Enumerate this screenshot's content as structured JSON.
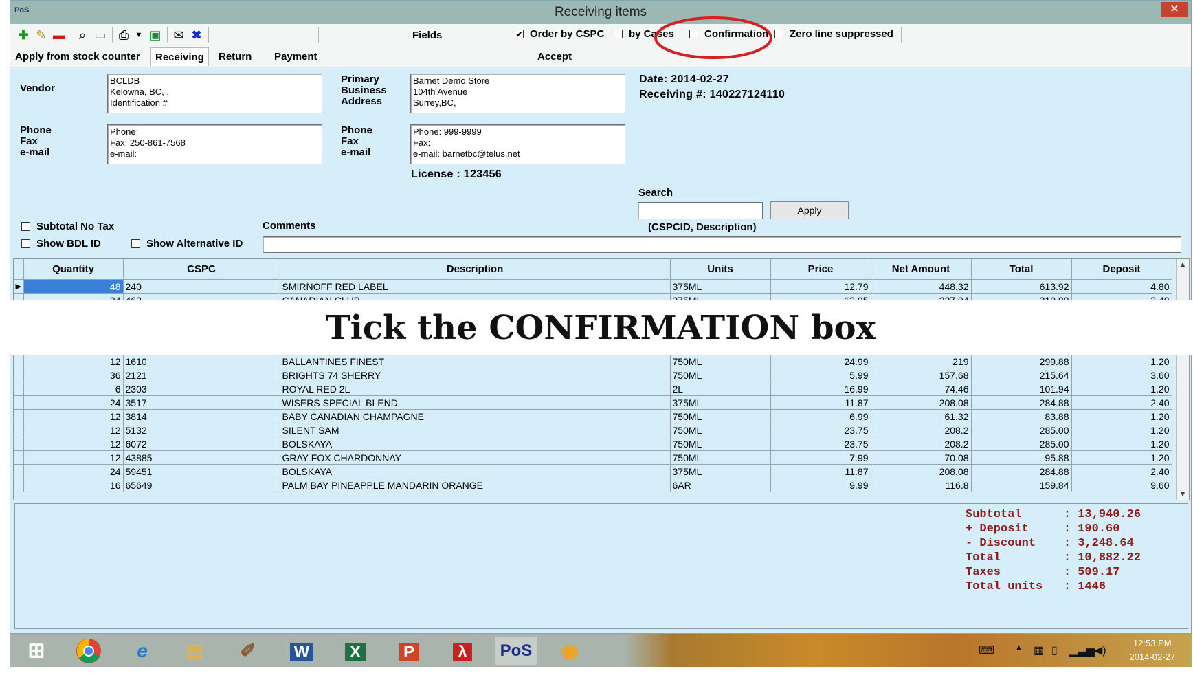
{
  "window": {
    "logo": "PoS",
    "title": "Receiving items",
    "close_label": "✕"
  },
  "toolbar": {
    "icons": [
      "add-icon",
      "edit-icon",
      "delete-icon",
      "preview-icon",
      "blank-icon",
      "print-icon",
      "dropdown-icon",
      "export-icon",
      "email-icon",
      "cancel-icon"
    ],
    "fields_label": "Fields",
    "options": [
      {
        "label": "Order by CSPC",
        "checked": true
      },
      {
        "label": "by Cases",
        "checked": false
      },
      {
        "label": "Confirmation",
        "checked": false
      },
      {
        "label": "Zero line suppressed",
        "checked": false
      }
    ]
  },
  "menu": {
    "apply_stock": "Apply from stock counter",
    "receiving": "Receiving",
    "return": "Return",
    "payment": "Payment",
    "accept": "Accept"
  },
  "vendor": {
    "label": "Vendor",
    "address": [
      "BCLDB",
      " Kelowna, BC, ,",
      "Identification #"
    ],
    "contact_labels": [
      "Phone",
      "Fax",
      "e-mail"
    ],
    "contact": [
      "Phone:",
      "Fax: 250-861-7568",
      "e-mail:"
    ]
  },
  "business": {
    "label": [
      "Primary",
      "Business",
      "Address"
    ],
    "address": [
      "Barnet Demo Store",
      "104th Avenue",
      "Surrey,BC,"
    ],
    "contact_labels": [
      "Phone",
      "Fax",
      "e-mail"
    ],
    "contact": [
      "Phone: 999-9999",
      "Fax:",
      "e-mail: barnetbc@telus.net"
    ],
    "license": "License :  123456"
  },
  "doc": {
    "date": "Date: 2014-02-27",
    "receiving_no": "Receiving #: 140227124110"
  },
  "search": {
    "label": "Search",
    "value": "",
    "apply": "Apply",
    "hint": "(CSPCID, Description)"
  },
  "options": {
    "subtotal_no_tax": "Subtotal No Tax",
    "show_bdl_id": "Show BDL ID",
    "show_alt_id": "Show Alternative ID",
    "comments_label": "Comments",
    "comments_value": ""
  },
  "grid": {
    "columns": [
      "Quantity",
      "CSPC",
      "Description",
      "Units",
      "Price",
      "Net Amount",
      "Total",
      "Deposit"
    ],
    "rows_top": [
      [
        "48",
        "240",
        "SMIRNOFF RED LABEL",
        "375ML",
        "12.79",
        "448.32",
        "613.92",
        "4.80"
      ],
      [
        "24",
        "463",
        "CANADIAN CLUB",
        "375ML",
        "12.95",
        "227.04",
        "310.80",
        "2.40"
      ]
    ],
    "rows_bottom": [
      [
        "12",
        "1610",
        "BALLANTINES FINEST",
        "750ML",
        "24.99",
        "219",
        "299.88",
        "1.20"
      ],
      [
        "36",
        "2121",
        "BRIGHTS 74 SHERRY",
        "750ML",
        "5.99",
        "157.68",
        "215.64",
        "3.60"
      ],
      [
        "6",
        "2303",
        "ROYAL RED 2L",
        "2L",
        "16.99",
        "74.46",
        "101.94",
        "1.20"
      ],
      [
        "24",
        "3517",
        "WISERS SPECIAL BLEND",
        "375ML",
        "11.87",
        "208.08",
        "284.88",
        "2.40"
      ],
      [
        "12",
        "3814",
        "BABY CANADIAN CHAMPAGNE",
        "750ML",
        "6.99",
        "61.32",
        "83.88",
        "1.20"
      ],
      [
        "12",
        "5132",
        "SILENT SAM",
        "750ML",
        "23.75",
        "208.2",
        "285.00",
        "1.20"
      ],
      [
        "12",
        "6072",
        "BOLSKAYA",
        "750ML",
        "23.75",
        "208.2",
        "285.00",
        "1.20"
      ],
      [
        "12",
        "43885",
        "GRAY FOX CHARDONNAY",
        "750ML",
        "7.99",
        "70.08",
        "95.88",
        "1.20"
      ],
      [
        "24",
        "59451",
        "BOLSKAYA",
        "375ML",
        "11.87",
        "208.08",
        "284.88",
        "2.40"
      ],
      [
        "16",
        "65649",
        "PALM BAY PINEAPPLE MANDARIN ORANGE",
        "6AR",
        "9.99",
        "116.8",
        "159.84",
        "9.60"
      ]
    ]
  },
  "overlay_caption": "Tick the CONFIRMATION box",
  "totals": [
    "Subtotal      : 13,940.26",
    "+ Deposit     : 190.60",
    "- Discount    : 3,248.64",
    "Total         : 10,882.22",
    "Taxes         : 509.17",
    "Total units   : 1446"
  ],
  "taskbar": {
    "apps": [
      "start-icon",
      "chrome-icon",
      "ie-icon",
      "explorer-icon",
      "paint-icon",
      "word-icon",
      "excel-icon",
      "powerpoint-icon",
      "acrobat-icon",
      "pos-icon",
      "mail-icon"
    ],
    "pos_label": "PoS",
    "time": "12:53 PM",
    "date": "2014-02-27"
  },
  "colors": {
    "form_bg": "#d6eef9",
    "selection": "#3a80d8",
    "totals_text": "#8e1c1c",
    "highlight_circle": "#d62020"
  }
}
